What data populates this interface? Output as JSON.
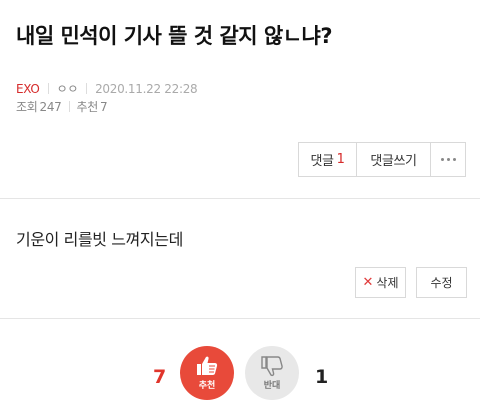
{
  "post": {
    "title": "내일 민석이 기사 뜰 것 같지 않ㄴ냐?",
    "category": "EXO",
    "author": "ㅇㅇ",
    "datetime": "2020.11.22 22:28",
    "views_label": "조회",
    "views": "247",
    "recommend_label": "추천",
    "recommend_count": "7"
  },
  "actions": {
    "comments_label": "댓글",
    "comments_count": "1",
    "write_comment_label": "댓글쓰기",
    "more_icon": "more-dots-icon"
  },
  "content": {
    "body": "기운이 리를빗 느껴지는데"
  },
  "edit": {
    "delete_label": "삭제",
    "delete_mark": "✕",
    "edit_label": "수정"
  },
  "vote": {
    "up_count": "7",
    "up_label": "추천",
    "up_icon": "thumbs-up-icon",
    "up_color": "#e84a3a",
    "down_count": "1",
    "down_label": "반대",
    "down_icon": "thumbs-down-icon",
    "down_color": "#e8e8e8"
  }
}
